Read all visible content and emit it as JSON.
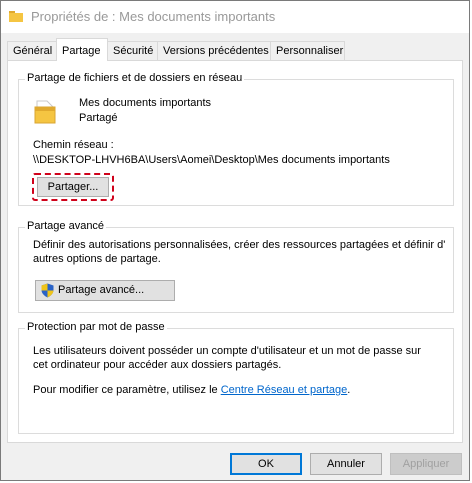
{
  "window": {
    "title": "Propriétés de : Mes documents importants"
  },
  "tabs": [
    {
      "label": "Général"
    },
    {
      "label": "Partage"
    },
    {
      "label": "Sécurité"
    },
    {
      "label": "Versions précédentes"
    },
    {
      "label": "Personnaliser"
    }
  ],
  "network_sharing": {
    "group_title": "Partage de fichiers et de dossiers en réseau",
    "folder_name": "Mes documents importants",
    "status": "Partagé",
    "path_label": "Chemin réseau :",
    "path_value": "\\\\DESKTOP-LHVH6BA\\Users\\Aomei\\Desktop\\Mes documents importants",
    "share_button": "Partager..."
  },
  "advanced_sharing": {
    "group_title": "Partage avancé",
    "description_line1": "Définir des autorisations personnalisées, créer des ressources partagées et définir d'",
    "description_line2": "autres options de partage.",
    "button": "Partage avancé..."
  },
  "password_protection": {
    "group_title": "Protection par mot de passe",
    "description_line1": "Les utilisateurs doivent posséder un compte d'utilisateur et un mot de passe sur",
    "description_line2": "cet ordinateur pour accéder aux dossiers partagés.",
    "settings_prefix": "Pour modifier ce paramètre, utilisez le ",
    "settings_link": "Centre Réseau et partage",
    "settings_suffix": "."
  },
  "footer": {
    "ok": "OK",
    "cancel": "Annuler",
    "apply": "Appliquer"
  },
  "colors": {
    "highlight": "#d0021b",
    "link": "#0066cc",
    "folder": "#f5c542"
  }
}
